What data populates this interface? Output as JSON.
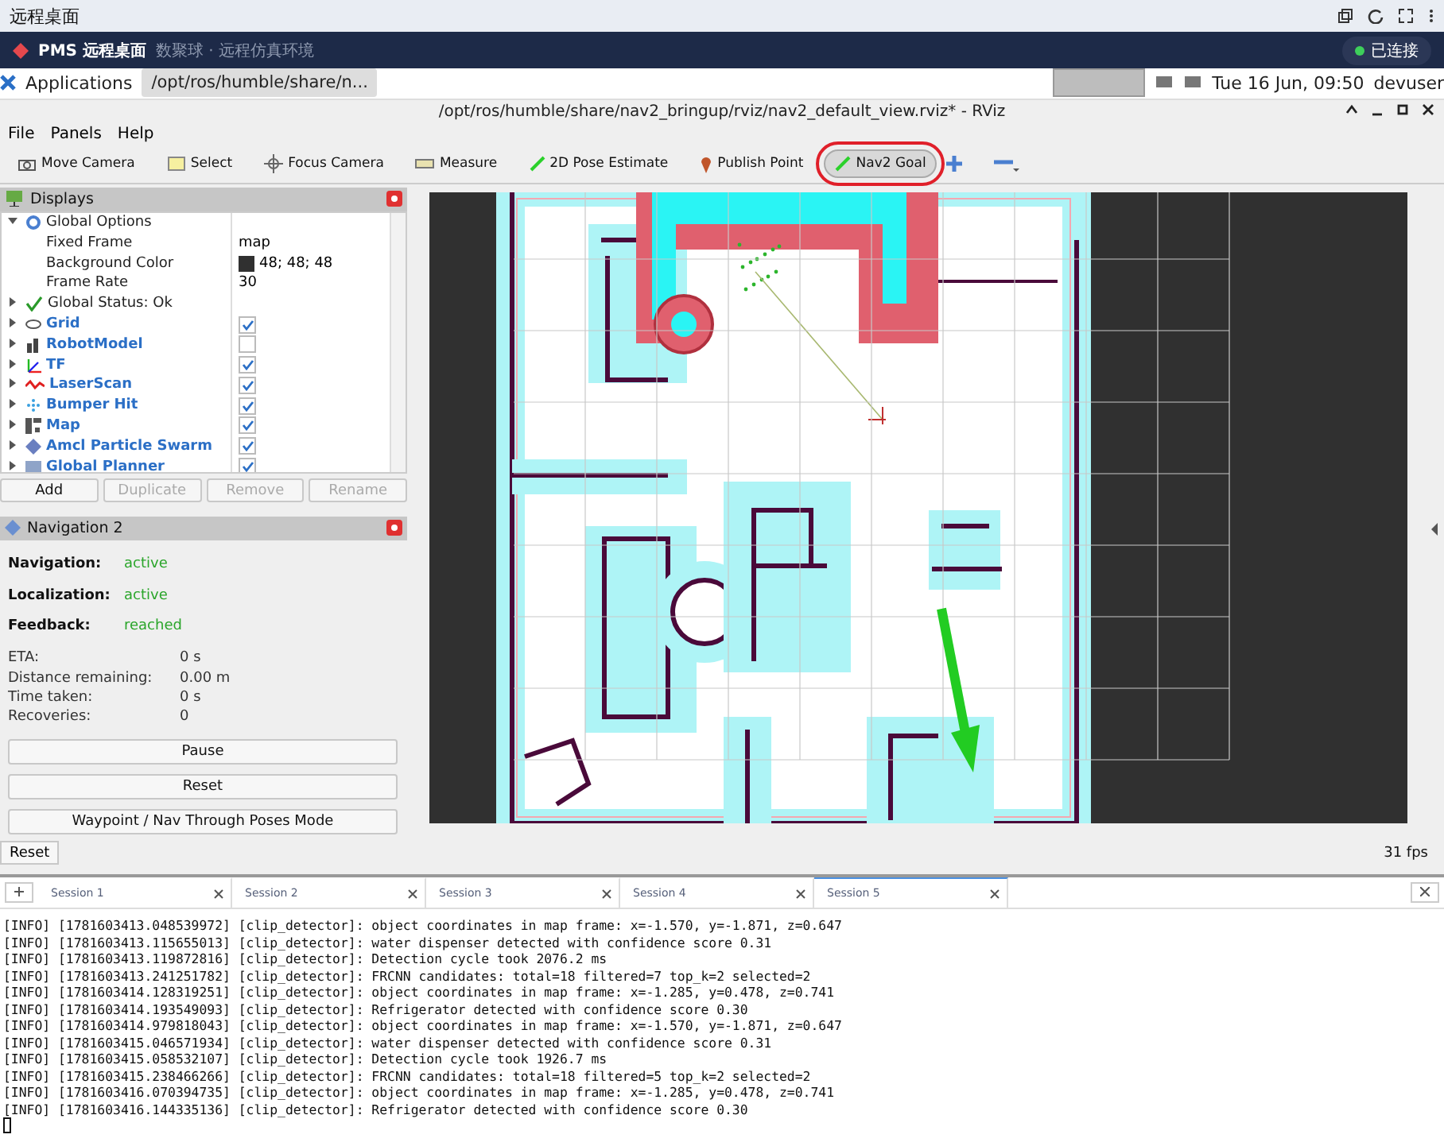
{
  "host_bar": {
    "title": "远程桌面"
  },
  "app_header": {
    "title": "PMS 远程桌面",
    "subtitle": "数聚球 · 远程仿真环境",
    "status": "已连接"
  },
  "panel": {
    "launcher": "Applications",
    "task": "/opt/ros/humble/share/n...",
    "clock": "Tue 16 Jun, 09:50",
    "user": "devuser"
  },
  "window": {
    "title": "/opt/ros/humble/share/nav2_bringup/rviz/nav2_default_view.rviz* - RViz"
  },
  "menu": [
    "File",
    "Panels",
    "Help"
  ],
  "toolbar": [
    {
      "label": "Move Camera",
      "selected": false,
      "circled": false
    },
    {
      "label": "Select",
      "selected": false,
      "circled": false
    },
    {
      "label": "Focus Camera",
      "selected": false,
      "circled": false
    },
    {
      "label": "Measure",
      "selected": false,
      "circled": false
    },
    {
      "label": "2D Pose Estimate",
      "selected": false,
      "circled": false
    },
    {
      "label": "Publish Point",
      "selected": false,
      "circled": false
    },
    {
      "label": "Nav2 Goal",
      "selected": true,
      "circled": true
    }
  ],
  "displays": {
    "title": "Displays",
    "tree": [
      {
        "kind": "group",
        "label": "Global Options",
        "expanded": true,
        "children": [
          {
            "label": "Fixed Frame",
            "value": "map"
          },
          {
            "label": "Background Color",
            "value": "48; 48; 48",
            "kind": "color"
          },
          {
            "label": "Frame Rate",
            "value": "30"
          }
        ]
      },
      {
        "kind": "status",
        "label": "Global Status: Ok",
        "expanded": false
      },
      {
        "kind": "display",
        "label": "Grid",
        "expanded": false,
        "checked": true
      },
      {
        "kind": "display",
        "label": "RobotModel",
        "expanded": false,
        "checked": false
      },
      {
        "kind": "display",
        "label": "TF",
        "expanded": false,
        "checked": true
      },
      {
        "kind": "display",
        "label": "LaserScan",
        "expanded": false,
        "checked": true
      },
      {
        "kind": "display",
        "label": "Bumper Hit",
        "expanded": false,
        "checked": true
      },
      {
        "kind": "display",
        "label": "Map",
        "expanded": false,
        "checked": true
      },
      {
        "kind": "display",
        "label": "Amcl Particle Swarm",
        "expanded": false,
        "checked": true
      },
      {
        "kind": "display",
        "label": "Global Planner",
        "expanded": false,
        "checked": true
      }
    ],
    "buttons": [
      {
        "label": "Add",
        "disabled": false
      },
      {
        "label": "Duplicate",
        "disabled": true
      },
      {
        "label": "Remove",
        "disabled": true
      },
      {
        "label": "Rename",
        "disabled": true
      }
    ]
  },
  "navigation": {
    "title": "Navigation 2",
    "states": [
      {
        "label": "Navigation:",
        "value": "active"
      },
      {
        "label": "Localization:",
        "value": "active"
      },
      {
        "label": "Feedback:",
        "value": "reached"
      }
    ],
    "metrics": [
      {
        "label": "ETA:",
        "value": "0 s"
      },
      {
        "label": "Distance remaining:",
        "value": "0.00 m"
      },
      {
        "label": "Time taken:",
        "value": "0 s"
      },
      {
        "label": "Recoveries:",
        "value": "0"
      }
    ],
    "buttons": [
      "Pause",
      "Reset",
      "Waypoint / Nav Through Poses Mode"
    ]
  },
  "reset_button": "Reset",
  "fps": "31 fps",
  "sessions": [
    {
      "label": "Session 1",
      "selected": false
    },
    {
      "label": "Session 2",
      "selected": false
    },
    {
      "label": "Session 3",
      "selected": false
    },
    {
      "label": "Session 4",
      "selected": false
    },
    {
      "label": "Session 5",
      "selected": true
    }
  ],
  "log": [
    "[INFO] [1781603413.048539972] [clip_detector]: object coordinates in map frame: x=-1.570, y=-1.871, z=0.647",
    "[INFO] [1781603413.115655013] [clip_detector]: water dispenser detected with confidence score 0.31",
    "[INFO] [1781603413.119872816] [clip_detector]: Detection cycle took 2076.2 ms",
    "[INFO] [1781603413.241251782] [clip_detector]: FRCNN candidates: total=18 filtered=7 top_k=2 selected=2",
    "[INFO] [1781603414.128319251] [clip_detector]: object coordinates in map frame: x=-1.285, y=0.478, z=0.741",
    "[INFO] [1781603414.193549093] [clip_detector]: Refrigerator detected with confidence score 0.30",
    "[INFO] [1781603414.979818043] [clip_detector]: object coordinates in map frame: x=-1.570, y=-1.871, z=0.647",
    "[INFO] [1781603415.046571934] [clip_detector]: water dispenser detected with confidence score 0.31",
    "[INFO] [1781603415.058532107] [clip_detector]: Detection cycle took 1926.7 ms",
    "[INFO] [1781603415.238466266] [clip_detector]: FRCNN candidates: total=18 filtered=5 top_k=2 selected=2",
    "[INFO] [1781603416.070394735] [clip_detector]: object coordinates in map frame: x=-1.285, y=0.478, z=0.741",
    "[INFO] [1781603416.144335136] [clip_detector]: Refrigerator detected with confidence score 0.30"
  ]
}
